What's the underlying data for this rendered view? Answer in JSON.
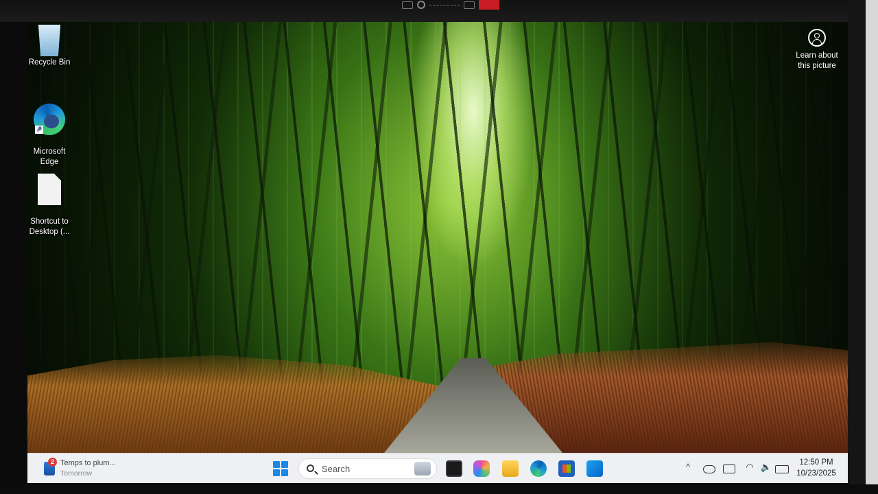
{
  "desktop": {
    "icons": [
      {
        "label": "Recycle Bin",
        "icon": "recycle-bin-icon"
      },
      {
        "label": "Microsoft\nEdge",
        "icon": "edge-icon"
      },
      {
        "label": "Shortcut to\nDesktop (...",
        "icon": "file-shortcut-icon"
      }
    ],
    "learn_about": {
      "label": "Learn about this picture",
      "icon": "camera-info-icon"
    }
  },
  "taskbar": {
    "weather": {
      "title": "Temps to plum...",
      "subtitle": "Tomorrow",
      "badge": "2",
      "icon": "weather-icon"
    },
    "start_icon": "windows-start-icon",
    "search": {
      "placeholder": "Search",
      "icon": "search-icon"
    },
    "apps": [
      {
        "name": "terminal",
        "icon": "terminal-icon"
      },
      {
        "name": "copilot",
        "icon": "copilot-icon"
      },
      {
        "name": "file-explorer",
        "icon": "folder-icon"
      },
      {
        "name": "edge",
        "icon": "edge-icon"
      },
      {
        "name": "store",
        "icon": "store-icon"
      },
      {
        "name": "outlook",
        "icon": "outlook-icon"
      }
    ],
    "tray": {
      "chevron": "^",
      "wifi_glyph": "◠",
      "volume_glyph": "🔈",
      "icons": [
        "chevron-up-icon",
        "onedrive-icon",
        "keyboard-icon",
        "wifi-icon",
        "volume-icon",
        "battery-icon"
      ]
    },
    "clock": {
      "time": "12:50 PM",
      "date": "10/23/2025"
    }
  },
  "colors": {
    "taskbar_bg": "#eef0f3",
    "accent_start": "#1b87e6",
    "wallpaper_green": "#2f6a14"
  }
}
